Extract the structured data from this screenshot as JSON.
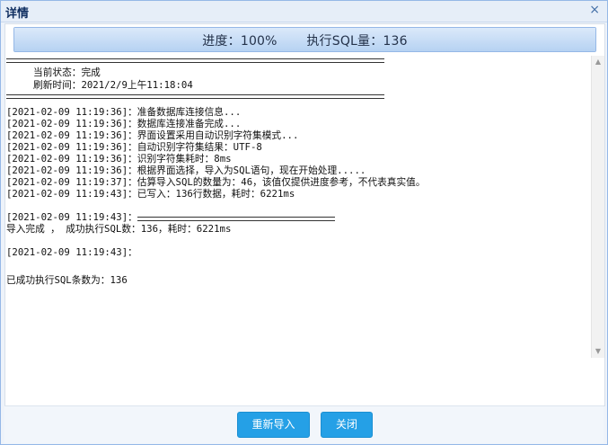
{
  "window": {
    "title": "详情",
    "close_symbol": "×"
  },
  "progress": {
    "label": "进度：100%",
    "sql_count_label": "执行SQL量：136",
    "percent": 100
  },
  "status": {
    "current_state": "当前状态：完成",
    "refresh_time": "刷新时间：2021/2/9上午11:18:04"
  },
  "log_lines": [
    "[2021-02-09 11:19:36]：准备数据库连接信息...",
    "[2021-02-09 11:19:36]：数据库连接准备完成...",
    "[2021-02-09 11:19:36]：界面设置采用自动识别字符集模式...",
    "[2021-02-09 11:19:36]：自动识别字符集结果：UTF-8",
    "[2021-02-09 11:19:36]：识别字符集耗时：8ms",
    "[2021-02-09 11:19:36]：根据界面选择，导入为SQL语句，现在开始处理.....",
    "[2021-02-09 11:19:37]：估算导入SQL的数量为：46，该值仅提供进度参考，不代表真实值。",
    "[2021-02-09 11:19:43]：已写入：136行数据，耗时：6221ms"
  ],
  "summary": {
    "timestamp_1": "[2021-02-09 11:19:43]：",
    "import_done": "导入完成 ， 成功执行SQL数：136，耗时：6221ms",
    "timestamp_2": "[2021-02-09 11:19:43]：",
    "success_count": "已成功执行SQL条数为：136"
  },
  "buttons": {
    "reimport": "重新导入",
    "close": "关闭"
  },
  "colors": {
    "button": "#25a0e6",
    "progress_border": "#95b8e7",
    "title": "#0e2d5f"
  }
}
